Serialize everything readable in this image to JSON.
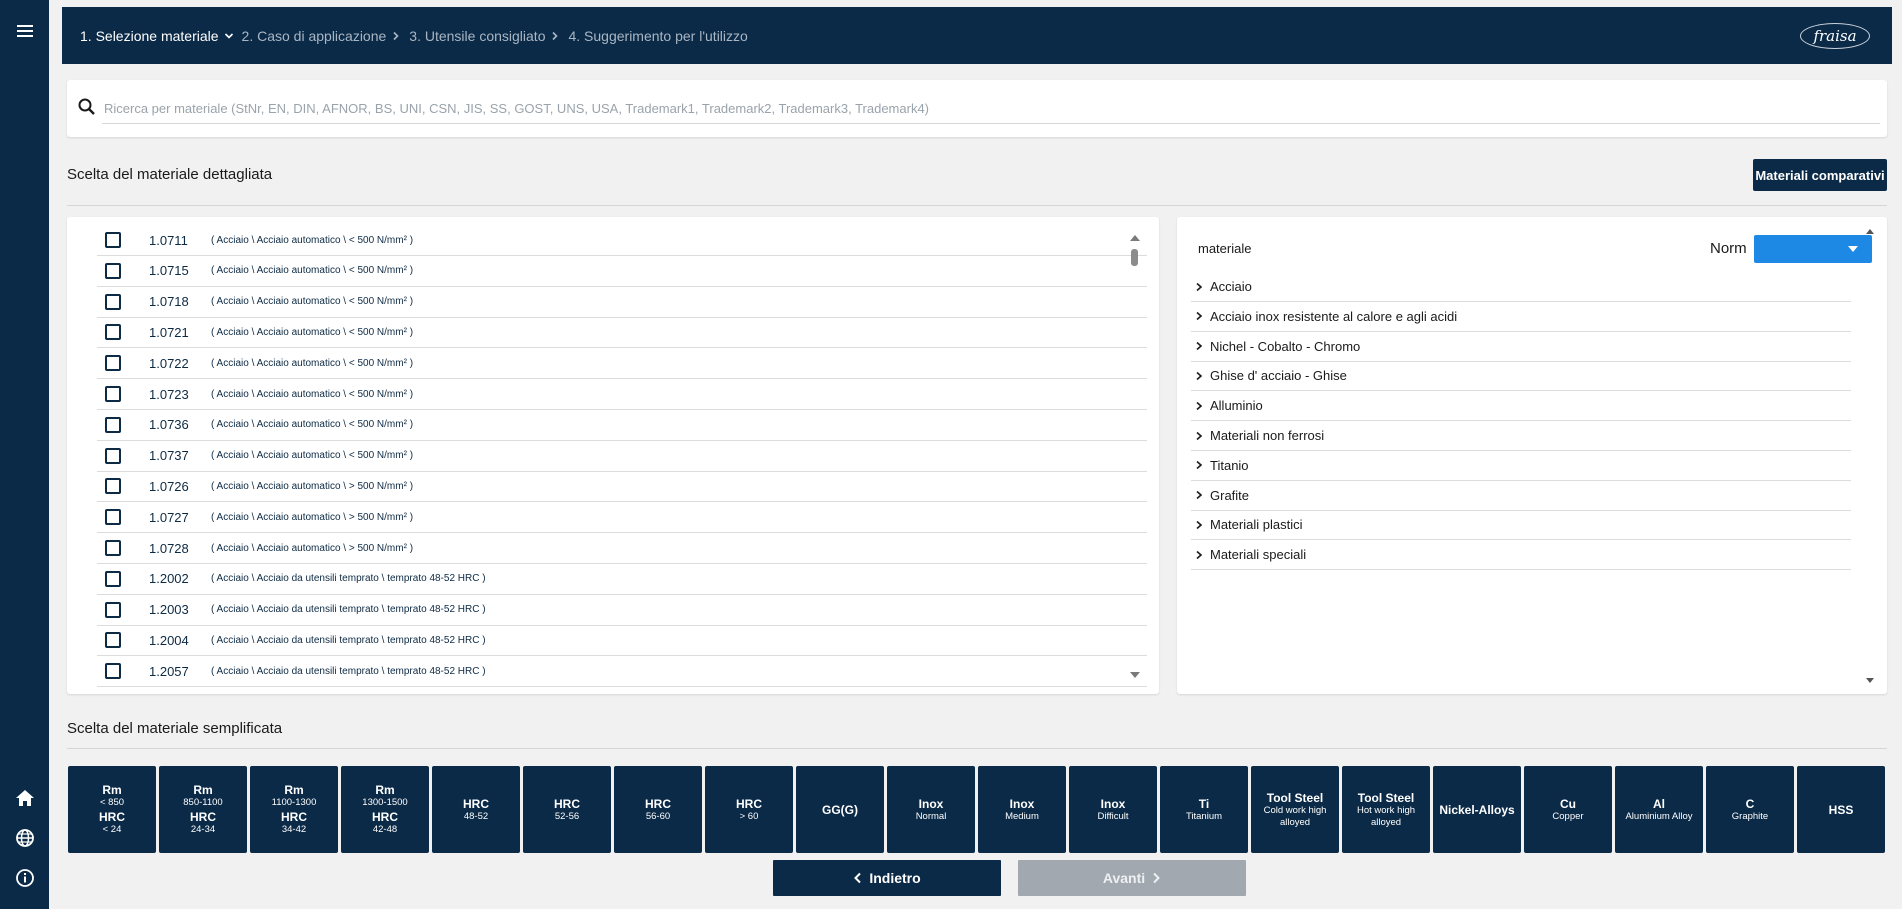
{
  "breadcrumb": [
    {
      "label": "1. Selezione materiale",
      "active": true
    },
    {
      "label": "2. Caso di applicazione",
      "active": false
    },
    {
      "label": "3. Utensile consigliato",
      "active": false
    },
    {
      "label": "4. Suggerimento per l'utilizzo",
      "active": false
    }
  ],
  "logo": "fraisa",
  "search": {
    "placeholder": "Ricerca per materiale (StNr, EN, DIN, AFNOR, BS, UNI, CSN, JIS, SS, GOST, UNS, USA, Trademark1, Trademark2, Trademark3, Trademark4)",
    "value": ""
  },
  "detailed": {
    "title": "Scelta del materiale dettagliata",
    "compare_button": "Materiali comparativi",
    "materials": [
      {
        "code": "1.0711",
        "desc": "( Acciaio \\ Acciaio automatico \\ < 500 N/mm² )"
      },
      {
        "code": "1.0715",
        "desc": "( Acciaio \\ Acciaio automatico \\ < 500 N/mm² )"
      },
      {
        "code": "1.0718",
        "desc": "( Acciaio \\ Acciaio automatico \\ < 500 N/mm² )"
      },
      {
        "code": "1.0721",
        "desc": "( Acciaio \\ Acciaio automatico \\ < 500 N/mm² )"
      },
      {
        "code": "1.0722",
        "desc": "( Acciaio \\ Acciaio automatico \\ < 500 N/mm² )"
      },
      {
        "code": "1.0723",
        "desc": "( Acciaio \\ Acciaio automatico \\ < 500 N/mm² )"
      },
      {
        "code": "1.0736",
        "desc": "( Acciaio \\ Acciaio automatico \\ < 500 N/mm² )"
      },
      {
        "code": "1.0737",
        "desc": "( Acciaio \\ Acciaio automatico \\ < 500 N/mm² )"
      },
      {
        "code": "1.0726",
        "desc": "( Acciaio \\ Acciaio automatico \\ > 500 N/mm² )"
      },
      {
        "code": "1.0727",
        "desc": "( Acciaio \\ Acciaio automatico \\ > 500 N/mm² )"
      },
      {
        "code": "1.0728",
        "desc": "( Acciaio \\ Acciaio automatico \\ > 500 N/mm² )"
      },
      {
        "code": "1.2002",
        "desc": "( Acciaio \\ Acciaio da utensili temprato \\ temprato 48-52 HRC )"
      },
      {
        "code": "1.2003",
        "desc": "( Acciaio \\ Acciaio da utensili temprato \\ temprato 48-52 HRC )"
      },
      {
        "code": "1.2004",
        "desc": "( Acciaio \\ Acciaio da utensili temprato \\ temprato 48-52 HRC )"
      },
      {
        "code": "1.2057",
        "desc": "( Acciaio \\ Acciaio da utensili temprato \\ temprato 48-52 HRC )"
      }
    ],
    "tree": {
      "title": "materiale",
      "norm_label": "Norm",
      "norm_value": "",
      "categories": [
        "Acciaio",
        "Acciaio inox resistente al calore e agli acidi",
        "Nichel - Cobalto - Chromo",
        "Ghise d' acciaio - Ghise",
        "Alluminio",
        "Materiali non ferrosi",
        "Titanio",
        "Grafite",
        "Materiali plastici",
        "Materiali speciali"
      ]
    }
  },
  "simplified": {
    "title": "Scelta del materiale semplificata",
    "tiles": [
      {
        "lines": [
          "Rm",
          "< 850",
          "HRC",
          "< 24"
        ]
      },
      {
        "lines": [
          "Rm",
          "850-1100",
          "HRC",
          "24-34"
        ]
      },
      {
        "lines": [
          "Rm",
          "1100-1300",
          "HRC",
          "34-42"
        ]
      },
      {
        "lines": [
          "Rm",
          "1300-1500",
          "HRC",
          "42-48"
        ]
      },
      {
        "lines": [
          "HRC",
          "48-52"
        ]
      },
      {
        "lines": [
          "HRC",
          "52-56"
        ]
      },
      {
        "lines": [
          "HRC",
          "56-60"
        ]
      },
      {
        "lines": [
          "HRC",
          "> 60"
        ]
      },
      {
        "lines": [
          "GG(G)"
        ]
      },
      {
        "lines": [
          "Inox",
          "Normal"
        ]
      },
      {
        "lines": [
          "Inox",
          "Medium"
        ]
      },
      {
        "lines": [
          "Inox",
          "Difficult"
        ]
      },
      {
        "lines": [
          "Ti",
          "Titanium"
        ]
      },
      {
        "lines": [
          "Tool Steel",
          "Cold work high alloyed"
        ]
      },
      {
        "lines": [
          "Tool Steel",
          "Hot work high alloyed"
        ]
      },
      {
        "lines": [
          "Nickel-Alloys"
        ]
      },
      {
        "lines": [
          "Cu",
          "Copper"
        ]
      },
      {
        "lines": [
          "Al",
          "Aluminium Alloy"
        ]
      },
      {
        "lines": [
          "C",
          "Graphite"
        ]
      },
      {
        "lines": [
          "HSS"
        ]
      }
    ]
  },
  "nav": {
    "back_label": "Indietro",
    "next_label": "Avanti",
    "next_enabled": false
  },
  "colors": {
    "primary": "#0b2a47",
    "accent": "#1e88e5",
    "disabled": "#a1a8b0",
    "background": "#f1f1f1"
  },
  "icons": [
    "menu-icon",
    "home-icon",
    "globe-icon",
    "info-icon",
    "search-icon",
    "chevron-down-icon",
    "chevron-right-icon",
    "caret-down-icon"
  ]
}
